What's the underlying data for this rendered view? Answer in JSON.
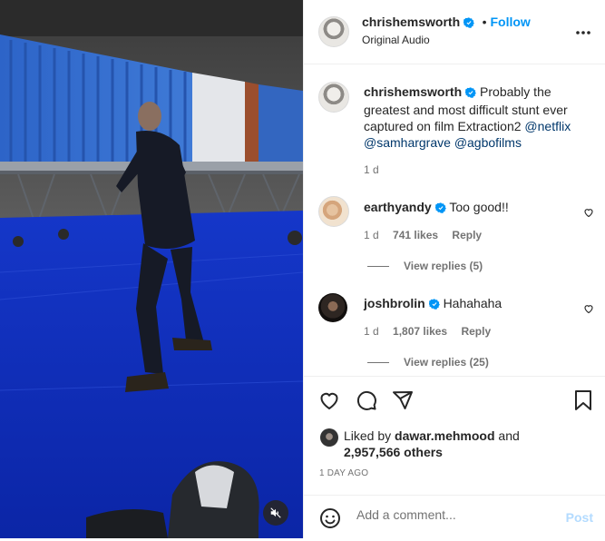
{
  "post": {
    "author": "chrishemsworth",
    "follow_label": "Follow",
    "audio_label": "Original Audio",
    "caption": {
      "author": "chrishemsworth",
      "text": "Probably the greatest and most difficult stunt ever captured on film Extraction2",
      "tags": [
        "@netflix",
        "@samhargrave",
        "@agbofilms"
      ],
      "age": "1 d"
    }
  },
  "comments": [
    {
      "username": "earthyandy",
      "text": "Too good!!",
      "age": "1 d",
      "likes": "741 likes",
      "reply_label": "Reply",
      "view_replies": "View replies (5)"
    },
    {
      "username": "joshbrolin",
      "text": "Hahahaha",
      "age": "1 d",
      "likes": "1,807 likes",
      "reply_label": "Reply",
      "view_replies": "View replies (25)"
    }
  ],
  "likes_section": {
    "liked_by_prefix": "Liked by",
    "liked_by_user": "dawar.mehmood",
    "and_label": "and",
    "others": "2,957,566 others"
  },
  "timestamp": "1 DAY AGO",
  "comment_box": {
    "placeholder": "Add a comment...",
    "post_label": "Post"
  },
  "icons": {
    "more": "more-options-icon",
    "like": "heart-icon",
    "comment": "comment-icon",
    "share": "share-icon",
    "save": "bookmark-icon",
    "emoji": "emoji-icon",
    "mute": "muted-speaker-icon",
    "verified": "verified-badge-icon"
  },
  "colors": {
    "link_blue": "#0095f6",
    "tag_blue": "#00376b",
    "verified_blue": "#0095f6",
    "muted_text": "#737373"
  }
}
